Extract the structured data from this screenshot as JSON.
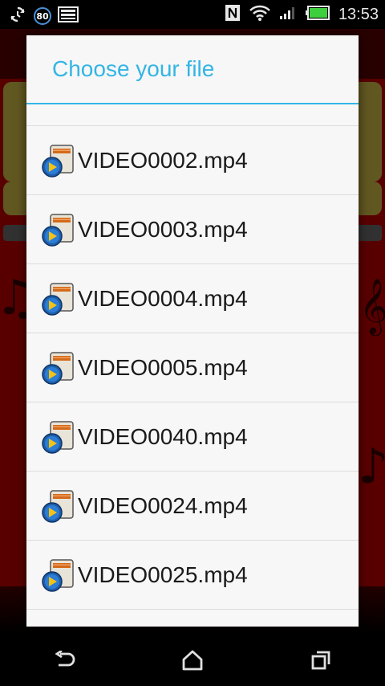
{
  "status_bar": {
    "notification_badge": "80",
    "time": "13:53",
    "icons": [
      "sync-icon",
      "badge-icon",
      "image-icon",
      "nfc-icon",
      "wifi-icon",
      "signal-icon",
      "battery-icon"
    ]
  },
  "dialog": {
    "title": "Choose your file",
    "files": [
      {
        "name": "VIDEO0002.mp4",
        "icon": "video-file-icon"
      },
      {
        "name": "VIDEO0003.mp4",
        "icon": "video-file-icon"
      },
      {
        "name": "VIDEO0004.mp4",
        "icon": "video-file-icon"
      },
      {
        "name": "VIDEO0005.mp4",
        "icon": "video-file-icon"
      },
      {
        "name": "VIDEO0040.mp4",
        "icon": "video-file-icon"
      },
      {
        "name": "VIDEO0024.mp4",
        "icon": "video-file-icon"
      },
      {
        "name": "VIDEO0025.mp4",
        "icon": "video-file-icon"
      }
    ]
  },
  "nav_bar": {
    "buttons": [
      "back-icon",
      "home-icon",
      "recents-icon"
    ]
  },
  "colors": {
    "accent": "#33b5e5",
    "background_app": "#c30000",
    "card": "#d8c04a"
  }
}
